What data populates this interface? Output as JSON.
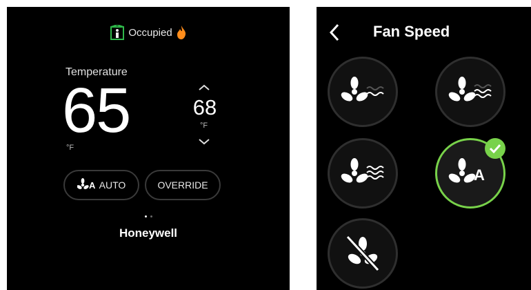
{
  "home": {
    "status": {
      "label": "Occupied",
      "icon": "building-person-icon",
      "flame_icon": "flame-icon"
    },
    "temperature": {
      "label": "Temperature",
      "value": "65",
      "unit": "°F"
    },
    "setpoint": {
      "value": "68",
      "unit": "°F",
      "up_icon": "chevron-up-icon",
      "down_icon": "chevron-down-icon"
    },
    "fan_mode_button": {
      "label": "AUTO",
      "icon": "fan-auto-icon"
    },
    "override_button": {
      "label": "OVERRIDE"
    },
    "pagination": {
      "pages": 2,
      "current": 1
    },
    "brand": "Honeywell"
  },
  "fan_screen": {
    "title": "Fan Speed",
    "back_icon": "chevron-left-icon",
    "options": [
      {
        "name": "fan-low",
        "icon": "fan-low-icon",
        "selected": false
      },
      {
        "name": "fan-medium",
        "icon": "fan-medium-icon",
        "selected": false
      },
      {
        "name": "fan-high",
        "icon": "fan-high-icon",
        "selected": false
      },
      {
        "name": "fan-auto",
        "icon": "fan-auto-icon",
        "selected": true
      },
      {
        "name": "fan-off",
        "icon": "fan-off-icon",
        "selected": false
      }
    ]
  },
  "colors": {
    "background": "#000000",
    "selected_accent": "#78d24a",
    "flame": "#ff8c1a",
    "status_icon": "#2fb84a"
  }
}
